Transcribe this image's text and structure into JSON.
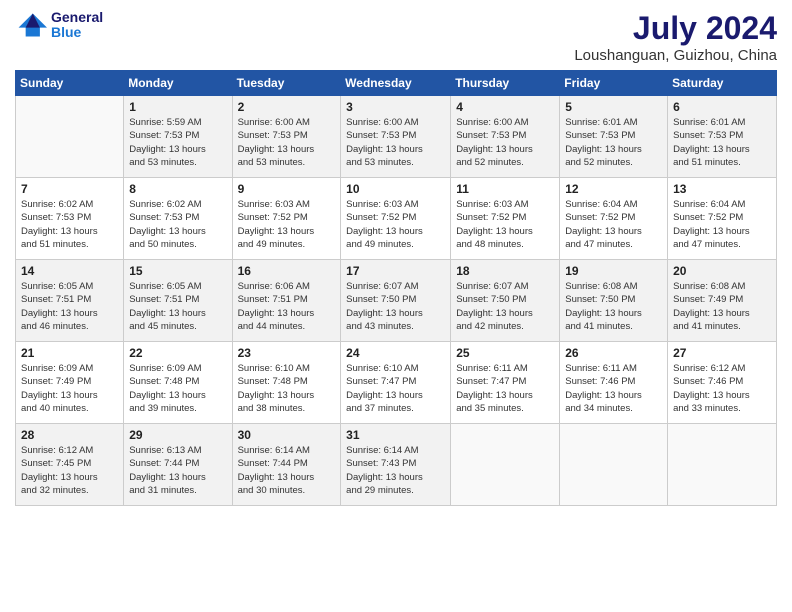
{
  "logo": {
    "line1": "General",
    "line2": "Blue"
  },
  "title": "July 2024",
  "subtitle": "Loushanguan, Guizhou, China",
  "weekdays": [
    "Sunday",
    "Monday",
    "Tuesday",
    "Wednesday",
    "Thursday",
    "Friday",
    "Saturday"
  ],
  "weeks": [
    [
      {
        "day": "",
        "info": ""
      },
      {
        "day": "1",
        "info": "Sunrise: 5:59 AM\nSunset: 7:53 PM\nDaylight: 13 hours\nand 53 minutes."
      },
      {
        "day": "2",
        "info": "Sunrise: 6:00 AM\nSunset: 7:53 PM\nDaylight: 13 hours\nand 53 minutes."
      },
      {
        "day": "3",
        "info": "Sunrise: 6:00 AM\nSunset: 7:53 PM\nDaylight: 13 hours\nand 53 minutes."
      },
      {
        "day": "4",
        "info": "Sunrise: 6:00 AM\nSunset: 7:53 PM\nDaylight: 13 hours\nand 52 minutes."
      },
      {
        "day": "5",
        "info": "Sunrise: 6:01 AM\nSunset: 7:53 PM\nDaylight: 13 hours\nand 52 minutes."
      },
      {
        "day": "6",
        "info": "Sunrise: 6:01 AM\nSunset: 7:53 PM\nDaylight: 13 hours\nand 51 minutes."
      }
    ],
    [
      {
        "day": "7",
        "info": "Sunrise: 6:02 AM\nSunset: 7:53 PM\nDaylight: 13 hours\nand 51 minutes."
      },
      {
        "day": "8",
        "info": "Sunrise: 6:02 AM\nSunset: 7:53 PM\nDaylight: 13 hours\nand 50 minutes."
      },
      {
        "day": "9",
        "info": "Sunrise: 6:03 AM\nSunset: 7:52 PM\nDaylight: 13 hours\nand 49 minutes."
      },
      {
        "day": "10",
        "info": "Sunrise: 6:03 AM\nSunset: 7:52 PM\nDaylight: 13 hours\nand 49 minutes."
      },
      {
        "day": "11",
        "info": "Sunrise: 6:03 AM\nSunset: 7:52 PM\nDaylight: 13 hours\nand 48 minutes."
      },
      {
        "day": "12",
        "info": "Sunrise: 6:04 AM\nSunset: 7:52 PM\nDaylight: 13 hours\nand 47 minutes."
      },
      {
        "day": "13",
        "info": "Sunrise: 6:04 AM\nSunset: 7:52 PM\nDaylight: 13 hours\nand 47 minutes."
      }
    ],
    [
      {
        "day": "14",
        "info": "Sunrise: 6:05 AM\nSunset: 7:51 PM\nDaylight: 13 hours\nand 46 minutes."
      },
      {
        "day": "15",
        "info": "Sunrise: 6:05 AM\nSunset: 7:51 PM\nDaylight: 13 hours\nand 45 minutes."
      },
      {
        "day": "16",
        "info": "Sunrise: 6:06 AM\nSunset: 7:51 PM\nDaylight: 13 hours\nand 44 minutes."
      },
      {
        "day": "17",
        "info": "Sunrise: 6:07 AM\nSunset: 7:50 PM\nDaylight: 13 hours\nand 43 minutes."
      },
      {
        "day": "18",
        "info": "Sunrise: 6:07 AM\nSunset: 7:50 PM\nDaylight: 13 hours\nand 42 minutes."
      },
      {
        "day": "19",
        "info": "Sunrise: 6:08 AM\nSunset: 7:50 PM\nDaylight: 13 hours\nand 41 minutes."
      },
      {
        "day": "20",
        "info": "Sunrise: 6:08 AM\nSunset: 7:49 PM\nDaylight: 13 hours\nand 41 minutes."
      }
    ],
    [
      {
        "day": "21",
        "info": "Sunrise: 6:09 AM\nSunset: 7:49 PM\nDaylight: 13 hours\nand 40 minutes."
      },
      {
        "day": "22",
        "info": "Sunrise: 6:09 AM\nSunset: 7:48 PM\nDaylight: 13 hours\nand 39 minutes."
      },
      {
        "day": "23",
        "info": "Sunrise: 6:10 AM\nSunset: 7:48 PM\nDaylight: 13 hours\nand 38 minutes."
      },
      {
        "day": "24",
        "info": "Sunrise: 6:10 AM\nSunset: 7:47 PM\nDaylight: 13 hours\nand 37 minutes."
      },
      {
        "day": "25",
        "info": "Sunrise: 6:11 AM\nSunset: 7:47 PM\nDaylight: 13 hours\nand 35 minutes."
      },
      {
        "day": "26",
        "info": "Sunrise: 6:11 AM\nSunset: 7:46 PM\nDaylight: 13 hours\nand 34 minutes."
      },
      {
        "day": "27",
        "info": "Sunrise: 6:12 AM\nSunset: 7:46 PM\nDaylight: 13 hours\nand 33 minutes."
      }
    ],
    [
      {
        "day": "28",
        "info": "Sunrise: 6:12 AM\nSunset: 7:45 PM\nDaylight: 13 hours\nand 32 minutes."
      },
      {
        "day": "29",
        "info": "Sunrise: 6:13 AM\nSunset: 7:44 PM\nDaylight: 13 hours\nand 31 minutes."
      },
      {
        "day": "30",
        "info": "Sunrise: 6:14 AM\nSunset: 7:44 PM\nDaylight: 13 hours\nand 30 minutes."
      },
      {
        "day": "31",
        "info": "Sunrise: 6:14 AM\nSunset: 7:43 PM\nDaylight: 13 hours\nand 29 minutes."
      },
      {
        "day": "",
        "info": ""
      },
      {
        "day": "",
        "info": ""
      },
      {
        "day": "",
        "info": ""
      }
    ]
  ]
}
